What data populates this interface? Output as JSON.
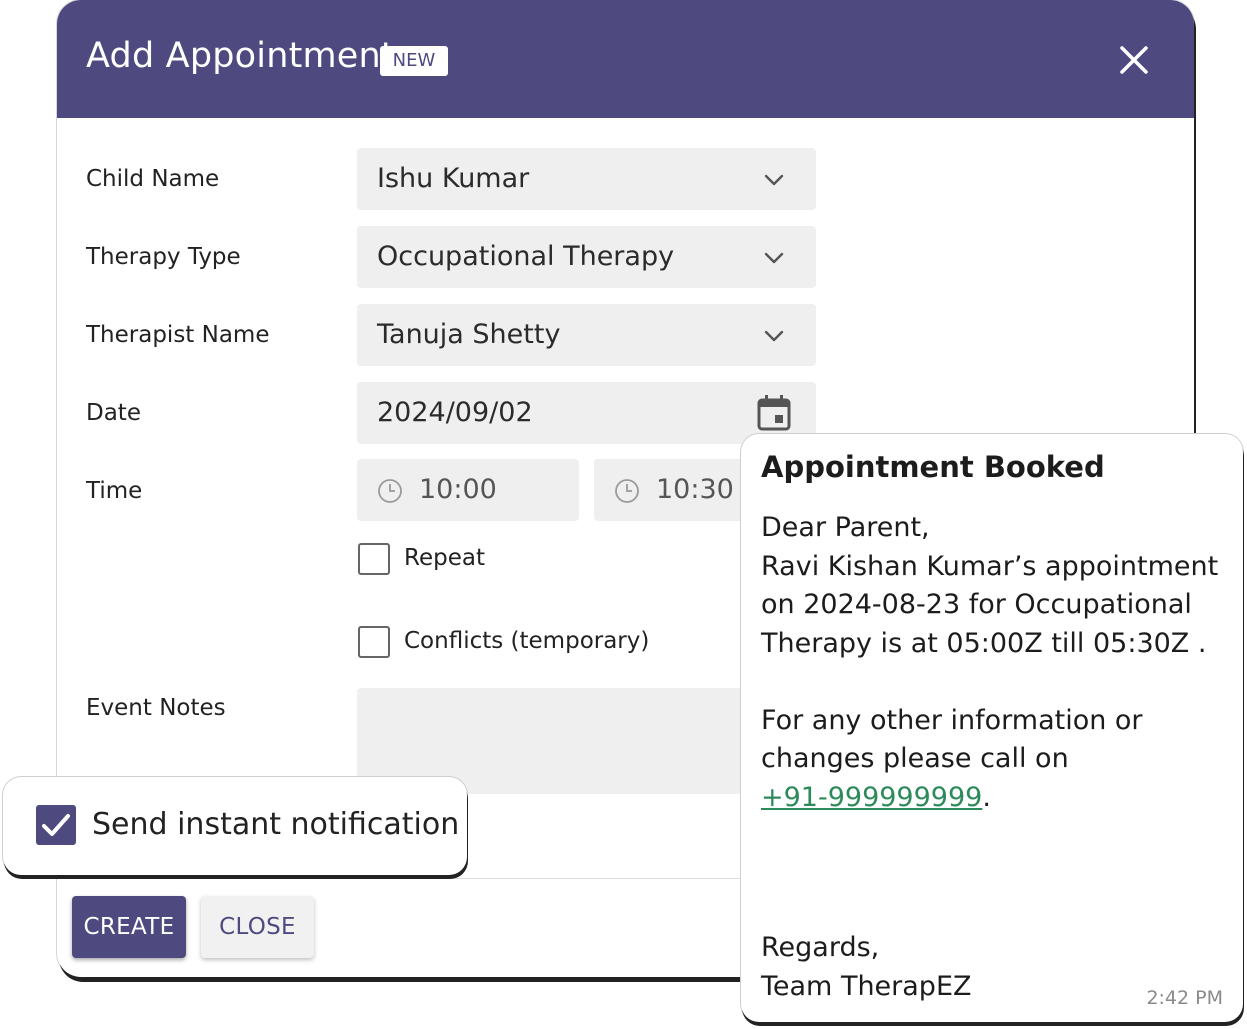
{
  "modal": {
    "title": "Add Appointment",
    "badge": "NEW",
    "header_color": "#4e4a80",
    "close_icon": "close-icon"
  },
  "form": {
    "child_name": {
      "label": "Child Name",
      "value": "Ishu Kumar"
    },
    "therapy_type": {
      "label": "Therapy Type",
      "value": "Occupational Therapy"
    },
    "therapist_name": {
      "label": "Therapist Name",
      "value": "Tanuja Shetty"
    },
    "date": {
      "label": "Date",
      "value": "2024/09/02",
      "icon": "calendar-icon"
    },
    "time": {
      "label": "Time",
      "start": "10:00",
      "end": "10:30",
      "icon": "clock-icon"
    },
    "repeat": {
      "label": "Repeat",
      "checked": false
    },
    "conflicts": {
      "label": "Conflicts (temporary)",
      "checked": false
    },
    "event_notes": {
      "label": "Event Notes",
      "value": ""
    }
  },
  "notification": {
    "label": "Send instant notification",
    "checked": true
  },
  "buttons": {
    "create": "CREATE",
    "close": "CLOSE"
  },
  "message": {
    "title": "Appointment Booked",
    "greeting": "Dear Parent,",
    "body_lines": [
      "Ravi Kishan Kumar’s appointment",
      "on 2024-08-23 for Occupational",
      "Therapy  is at 05:00Z till 05:30Z ."
    ],
    "info_lines": [
      "For any other information or",
      "changes please call on"
    ],
    "phone": "+91-999999999",
    "phone_suffix": ".",
    "regards": "Regards,",
    "team": "Team TherapEZ",
    "time": "2:42 PM",
    "link_color": "#2d8a5a"
  }
}
